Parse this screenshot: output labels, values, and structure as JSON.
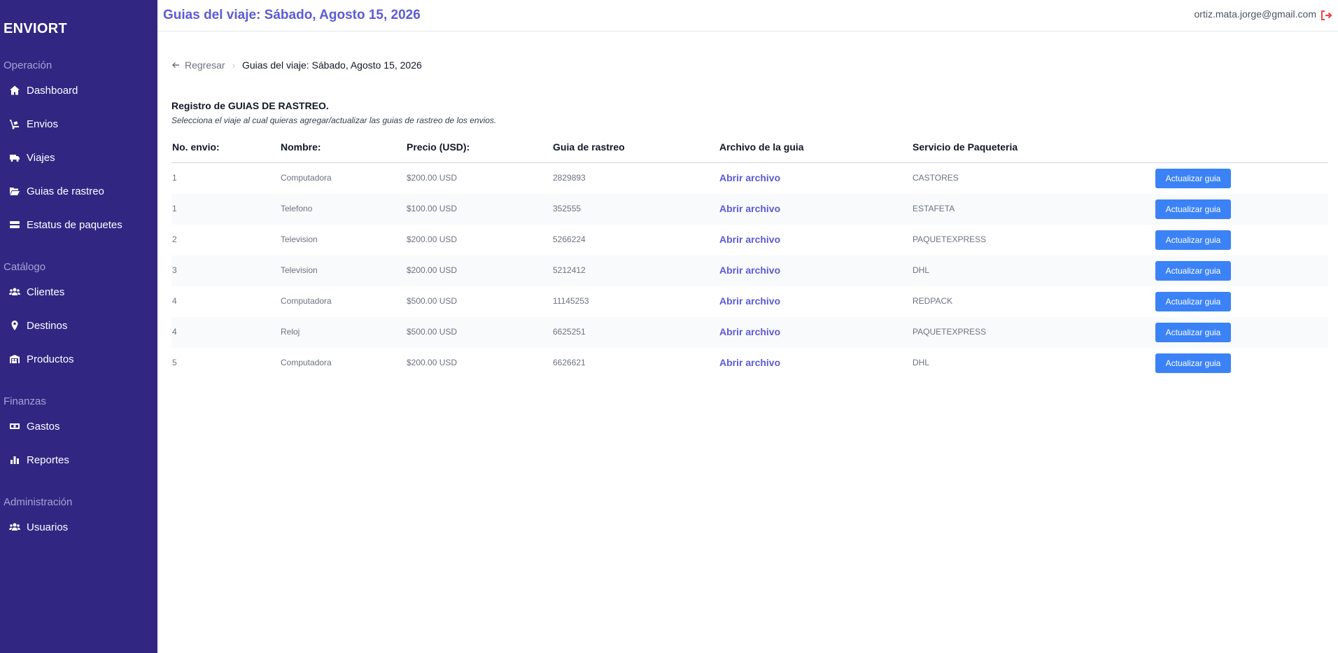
{
  "app": {
    "brand": "ENVIORT"
  },
  "header": {
    "title": "Guias del viaje: Sábado, Agosto 15, 2026",
    "user_email": "ortiz.mata.jorge@gmail.com"
  },
  "sidebar": {
    "sections": [
      {
        "label": "Operación",
        "items": [
          {
            "label": "Dashboard",
            "icon": "home-icon"
          },
          {
            "label": "Envios",
            "icon": "dolly-icon"
          },
          {
            "label": "Viajes",
            "icon": "truck-icon"
          },
          {
            "label": "Guias de rastreo",
            "icon": "folder-open-icon"
          },
          {
            "label": "Estatus de paquetes",
            "icon": "status-icon"
          }
        ]
      },
      {
        "label": "Catálogo",
        "items": [
          {
            "label": "Clientes",
            "icon": "users-icon"
          },
          {
            "label": "Destinos",
            "icon": "map-marker-icon"
          },
          {
            "label": "Productos",
            "icon": "warehouse-icon"
          }
        ]
      },
      {
        "label": "Finanzas",
        "items": [
          {
            "label": "Gastos",
            "icon": "money-icon"
          },
          {
            "label": "Reportes",
            "icon": "bar-chart-icon"
          }
        ]
      },
      {
        "label": "Administración",
        "items": [
          {
            "label": "Usuarios",
            "icon": "users-icon"
          }
        ]
      }
    ]
  },
  "breadcrumb": {
    "back_label": "Regresar",
    "current": "Guias del viaje: Sábado, Agosto 15, 2026"
  },
  "section": {
    "title": "Registro de GUIAS DE RASTREO.",
    "subtitle": "Selecciona el viaje al cual quieras agregar/actualizar las guias de rastreo de los envios."
  },
  "table": {
    "columns": [
      "No. envio:",
      "Nombre:",
      "Precio (USD):",
      "Guia de rastreo",
      "Archivo de la guia",
      "Servicio de Paqueteria"
    ],
    "rows": [
      {
        "no": "1",
        "nombre": "Computadora",
        "precio": "$200.00 USD",
        "guia": "2829893",
        "archivo": "Abrir archivo",
        "servicio": "CASTORES",
        "accion": "Actualizar guia"
      },
      {
        "no": "1",
        "nombre": "Telefono",
        "precio": "$100.00 USD",
        "guia": "352555",
        "archivo": "Abrir archivo",
        "servicio": "ESTAFETA",
        "accion": "Actualizar guia"
      },
      {
        "no": "2",
        "nombre": "Television",
        "precio": "$200.00 USD",
        "guia": "5266224",
        "archivo": "Abrir archivo",
        "servicio": "PAQUETEXPRESS",
        "accion": "Actualizar guia"
      },
      {
        "no": "3",
        "nombre": "Television",
        "precio": "$200.00 USD",
        "guia": "5212412",
        "archivo": "Abrir archivo",
        "servicio": "DHL",
        "accion": "Actualizar guia"
      },
      {
        "no": "4",
        "nombre": "Computadora",
        "precio": "$500.00 USD",
        "guia": "11145253",
        "archivo": "Abrir archivo",
        "servicio": "REDPACK",
        "accion": "Actualizar guia"
      },
      {
        "no": "4",
        "nombre": "Reloj",
        "precio": "$500.00 USD",
        "guia": "6625251",
        "archivo": "Abrir archivo",
        "servicio": "PAQUETEXPRESS",
        "accion": "Actualizar guia"
      },
      {
        "no": "5",
        "nombre": "Computadora",
        "precio": "$200.00 USD",
        "guia": "6626621",
        "archivo": "Abrir archivo",
        "servicio": "DHL",
        "accion": "Actualizar guia"
      }
    ]
  },
  "colors": {
    "sidebar_bg": "#312783",
    "accent": "#5b5bd6",
    "button": "#3b82f6",
    "logout": "#ef4444"
  }
}
